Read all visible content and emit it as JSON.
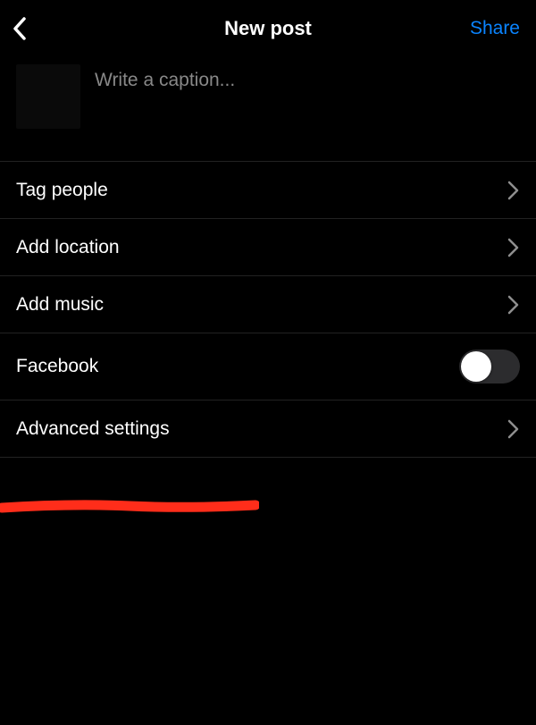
{
  "header": {
    "title": "New post",
    "share_label": "Share"
  },
  "caption": {
    "placeholder": "Write a caption...",
    "value": ""
  },
  "options": {
    "tag_people": "Tag people",
    "add_location": "Add location",
    "add_music": "Add music",
    "facebook": "Facebook",
    "advanced_settings": "Advanced settings"
  },
  "colors": {
    "accent": "#0a84ff",
    "annotation": "#ff2d1a"
  }
}
